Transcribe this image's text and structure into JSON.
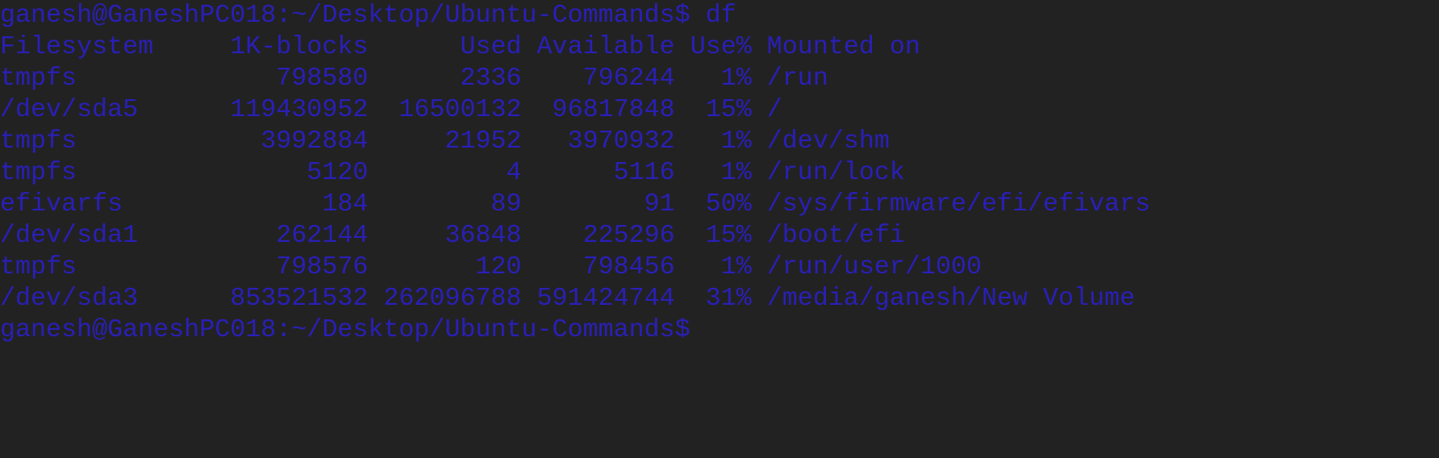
{
  "terminal": {
    "colors": {
      "background": "#222222",
      "text": "#2a1fb8"
    },
    "lines": [
      "ganesh@GaneshPC018:~/Desktop/Ubuntu-Commands$ df",
      "Filesystem     1K-blocks      Used Available Use% Mounted on",
      "tmpfs             798580      2336    796244   1% /run",
      "/dev/sda5      119430952  16500132  96817848  15% /",
      "tmpfs            3992884     21952   3970932   1% /dev/shm",
      "tmpfs               5120         4      5116   1% /run/lock",
      "efivarfs             184        89        91  50% /sys/firmware/efi/efivars",
      "/dev/sda1         262144     36848    225296  15% /boot/efi",
      "tmpfs             798576       120    798456   1% /run/user/1000",
      "/dev/sda3      853521532 262096788 591424744  31% /media/ganesh/New Volume",
      "ganesh@GaneshPC018:~/Desktop/Ubuntu-Commands$"
    ]
  }
}
